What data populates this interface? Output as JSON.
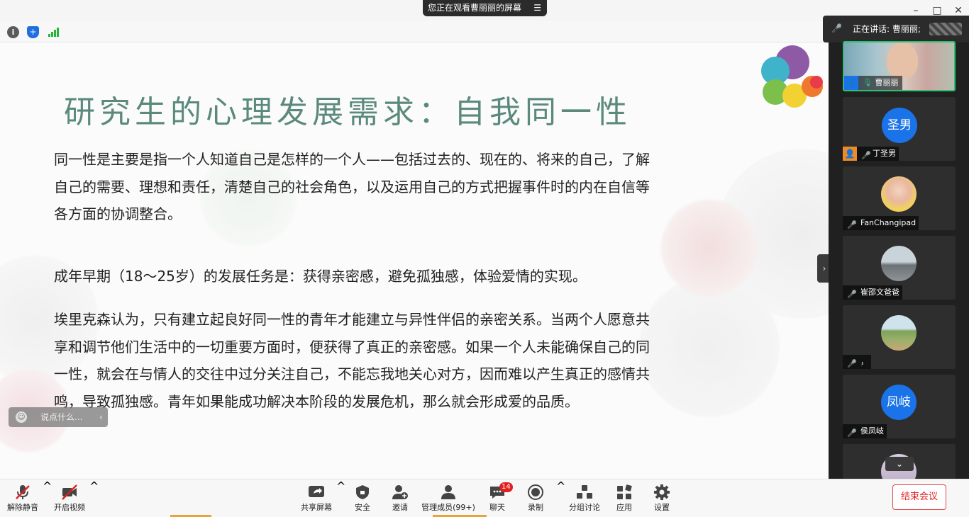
{
  "banner": {
    "viewing": "您正在观看曹丽丽的屏幕",
    "menu_icon": "menu-lines-icon"
  },
  "window": {
    "minimize": "–",
    "maximize": "□",
    "close": "✕"
  },
  "status_icons": [
    "info-icon",
    "encryption-shield-icon",
    "signal-icon"
  ],
  "speaking": {
    "label": "正在讲话: 曹丽丽;"
  },
  "slide": {
    "title": "研究生的心理发展需求：自我同一性",
    "para1": "同一性是主要是指一个人知道自己是怎样的一个人——包括过去的、现在的、将来的自己，了解自己的需要、理想和责任，清楚自己的社会角色，以及运用自己的方式把握事件时的内在自信等各方面的协调整合。",
    "para2": "成年早期（18～25岁）的发展任务是：获得亲密感，避免孤独感，体验爱情的实现。",
    "para3": "埃里克森认为，只有建立起良好同一性的青年才能建立与异性伴侣的亲密关系。当两个人愿意共享和调节他们生活中的一切重要方面时，便获得了真正的亲密感。如果一个人未能确保自己的同一性，就会在与情人的交往中过分关注自己，不能忘我地关心对方，因而难以产生真正的感情共鸣，导致孤独感。青年如果能成功解决本阶段的发展危机，那么就会形成爱的品质。"
  },
  "chat_input": {
    "placeholder": "说点什么..."
  },
  "participants": [
    {
      "name": "曹丽丽",
      "avatar": "video"
    },
    {
      "name": "丁圣男",
      "avatar": "圣男"
    },
    {
      "name": "FanChangipad",
      "avatar": "photo"
    },
    {
      "name": "崔邵文爸爸",
      "avatar": "photo"
    },
    {
      "name": "，",
      "avatar": "photo"
    },
    {
      "name": "侯凤岐",
      "avatar": "凤岐"
    }
  ],
  "toolbar": {
    "unmute": "解除静音",
    "video": "开启视频",
    "share": "共享屏幕",
    "security": "安全",
    "invite": "邀请",
    "participants": "管理成员(99+)",
    "chat": "聊天",
    "chat_badge": "14",
    "record": "录制",
    "breakout": "分组讨论",
    "apps": "应用",
    "settings": "设置",
    "end": "结束会议"
  },
  "colors": {
    "accent_green": "#2fbf71",
    "end_red": "#e02020",
    "title_teal": "#5b8a7c"
  }
}
